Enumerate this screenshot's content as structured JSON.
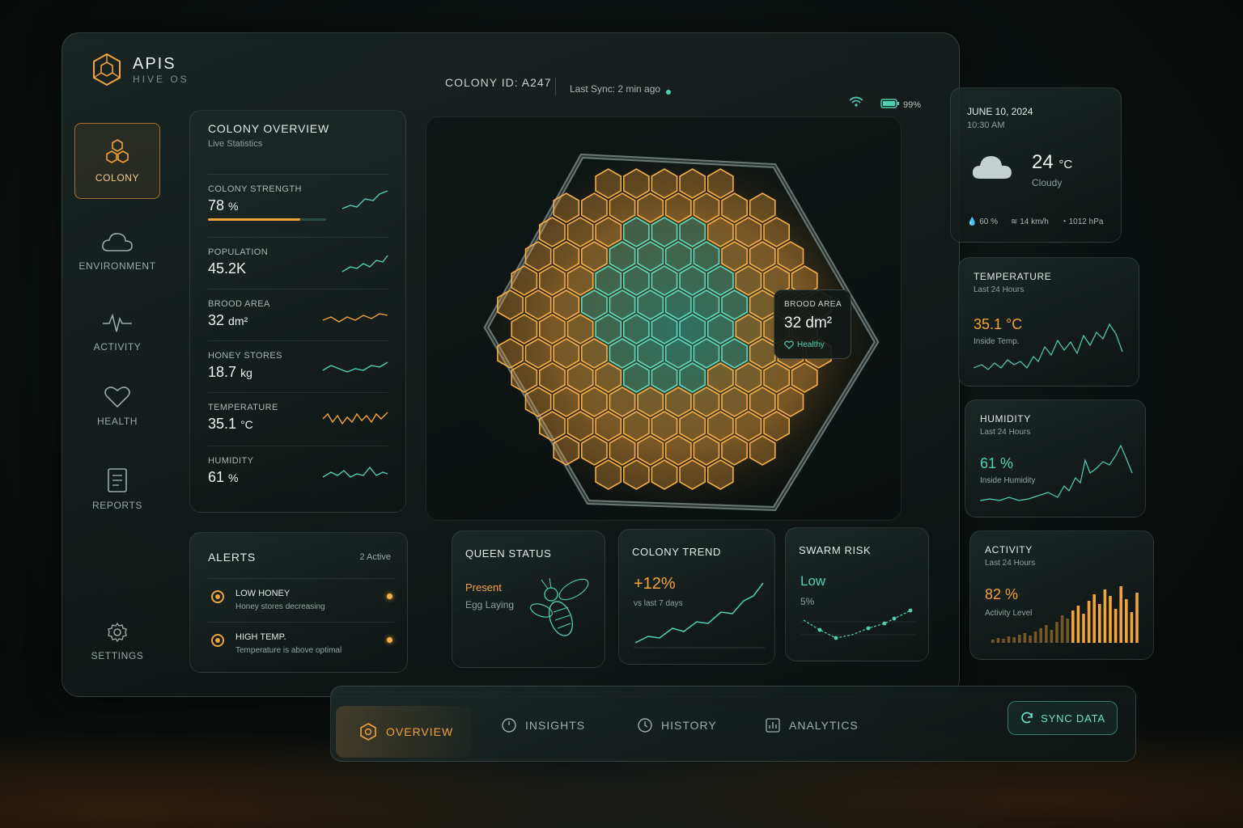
{
  "app": {
    "title": "APIS",
    "subtitle": "HIVE OS"
  },
  "header": {
    "colony_label": "COLONY ID:",
    "colony_id": "A247",
    "last_sync": "Last Sync: 2 min ago",
    "battery": "99%"
  },
  "nav": [
    {
      "label": "COLONY",
      "icon": "honeycomb-icon",
      "active": true
    },
    {
      "label": "ENVIRONMENT",
      "icon": "cloud-icon"
    },
    {
      "label": "ACTIVITY",
      "icon": "pulse-icon"
    },
    {
      "label": "HEALTH",
      "icon": "heart-icon"
    },
    {
      "label": "REPORTS",
      "icon": "document-icon"
    },
    {
      "label": "SETTINGS",
      "icon": "gear-icon"
    }
  ],
  "overview": {
    "title": "COLONY OVERVIEW",
    "subtitle": "Live Statistics",
    "metrics": [
      {
        "label": "COLONY STRENGTH",
        "value": "78",
        "unit": "%",
        "progress": 0.78
      },
      {
        "label": "POPULATION",
        "value": "45.2K",
        "unit": ""
      },
      {
        "label": "BROOD AREA",
        "value": "32",
        "unit": "dm²"
      },
      {
        "label": "HONEY STORES",
        "value": "18.7",
        "unit": "kg"
      },
      {
        "label": "TEMPERATURE",
        "value": "35.1",
        "unit": "°C"
      },
      {
        "label": "HUMIDITY",
        "value": "61",
        "unit": "%"
      }
    ]
  },
  "alerts": {
    "title": "ALERTS",
    "count": "2 Active",
    "items": [
      {
        "title": "LOW HONEY",
        "desc": "Honey stores decreasing"
      },
      {
        "title": "HIGH TEMP.",
        "desc": "Temperature is above optimal"
      }
    ]
  },
  "brood_popup": {
    "label": "BROOD AREA",
    "value": "32 dm²",
    "status": "Healthy"
  },
  "queen": {
    "title": "QUEEN STATUS",
    "status": "Present",
    "detail": "Egg Laying"
  },
  "trend": {
    "title": "COLONY TREND",
    "value": "+12%",
    "caption": "vs last 7 days"
  },
  "swarm": {
    "title": "SWARM RISK",
    "level": "Low",
    "percent": "5%"
  },
  "weather": {
    "date": "JUNE 10, 2024",
    "time": "10:30 AM",
    "temp": "24",
    "temp_unit": "°C",
    "condition": "Cloudy",
    "humidity": "60 %",
    "wind": "14 km/h",
    "pressure": "1012 hPa"
  },
  "temperature_card": {
    "title": "TEMPERATURE",
    "subtitle": "Last 24 Hours",
    "value": "35.1 °C",
    "caption": "Inside Temp."
  },
  "humidity_card": {
    "title": "HUMIDITY",
    "subtitle": "Last 24 Hours",
    "value": "61 %",
    "caption": "Inside Humidity"
  },
  "activity_card": {
    "title": "ACTIVITY",
    "subtitle": "Last 24 Hours",
    "value": "82 %",
    "caption": "Activity Level"
  },
  "tabs": [
    {
      "label": "OVERVIEW",
      "icon": "honeycomb-icon",
      "active": true
    },
    {
      "label": "INSIGHTS",
      "icon": "compass-icon"
    },
    {
      "label": "HISTORY",
      "icon": "clock-icon"
    },
    {
      "label": "ANALYTICS",
      "icon": "chart-icon"
    }
  ],
  "sync_button": "SYNC DATA",
  "colors": {
    "amber": "#f2a33a",
    "teal": "#4fd1b5",
    "background": "#0b1110"
  }
}
